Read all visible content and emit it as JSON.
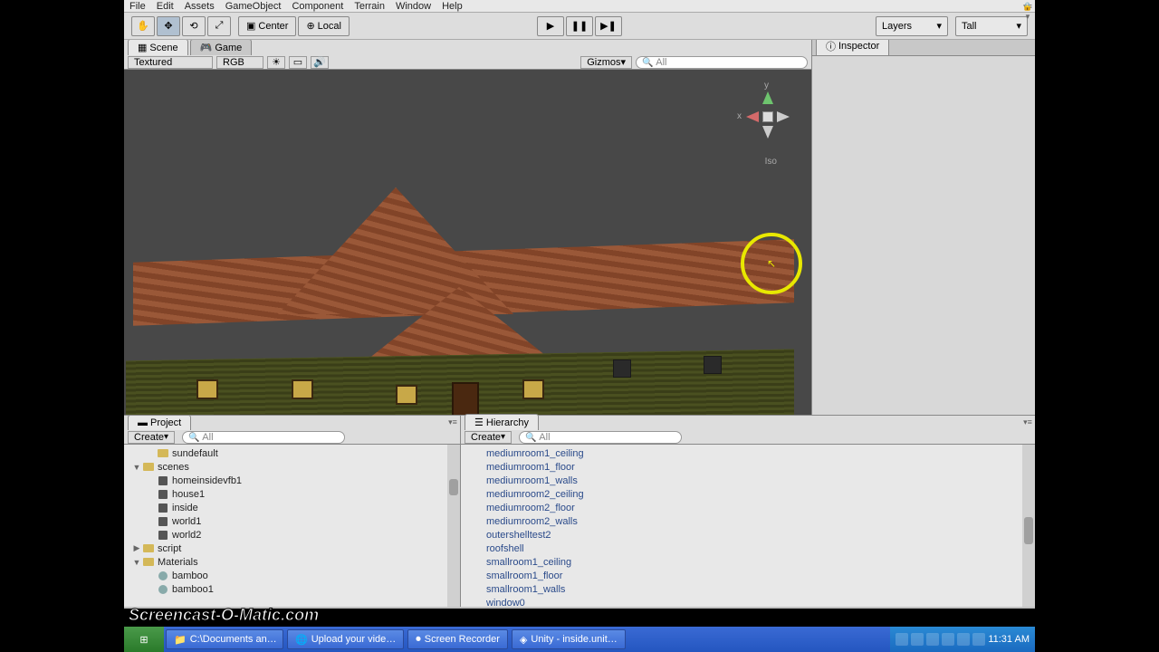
{
  "menu": [
    "File",
    "Edit",
    "Assets",
    "GameObject",
    "Component",
    "Terrain",
    "Window",
    "Help"
  ],
  "toolbar": {
    "pivot": "Center",
    "handle": "Local",
    "layers": "Layers",
    "layout": "Tall"
  },
  "scene": {
    "tabs": {
      "scene": "Scene",
      "game": "Game"
    },
    "render": "Textured",
    "color": "RGB",
    "gizmos": "Gizmos",
    "search": "All",
    "iso": "Iso",
    "axes": {
      "x": "x",
      "y": "y"
    }
  },
  "inspector": {
    "title": "Inspector"
  },
  "panels": {
    "project": "Project",
    "hierarchy": "Hierarchy",
    "create": "Create",
    "search": "All"
  },
  "project_tree": [
    {
      "indent": 1,
      "tw": "",
      "type": "folder",
      "name": "sundefault"
    },
    {
      "indent": 0,
      "tw": "▼",
      "type": "folder",
      "name": "scenes"
    },
    {
      "indent": 1,
      "tw": "",
      "type": "unity",
      "name": "homeinsidevfb1"
    },
    {
      "indent": 1,
      "tw": "",
      "type": "unity",
      "name": "house1"
    },
    {
      "indent": 1,
      "tw": "",
      "type": "unity",
      "name": "inside"
    },
    {
      "indent": 1,
      "tw": "",
      "type": "unity",
      "name": "world1"
    },
    {
      "indent": 1,
      "tw": "",
      "type": "unity",
      "name": "world2"
    },
    {
      "indent": 0,
      "tw": "▶",
      "type": "folder",
      "name": "script"
    },
    {
      "indent": 0,
      "tw": "▼",
      "type": "folder",
      "name": "Materials"
    },
    {
      "indent": 1,
      "tw": "",
      "type": "mat",
      "name": "bamboo"
    },
    {
      "indent": 1,
      "tw": "",
      "type": "mat",
      "name": "bamboo1"
    }
  ],
  "hierarchy_items": [
    "mediumroom1_ceiling",
    "mediumroom1_floor",
    "mediumroom1_walls",
    "mediumroom2_ceiling",
    "mediumroom2_floor",
    "mediumroom2_walls",
    "outershelltest2",
    "roofshell",
    "smallroom1_ceiling",
    "smallroom1_floor",
    "smallroom1_walls",
    "window0"
  ],
  "watermark": "Screencast-O-Matic.com",
  "taskbar": {
    "items": [
      "C:\\Documents an…",
      "Upload your vide…",
      "Screen Recorder",
      "Unity - inside.unit…"
    ],
    "time": "11:31 AM"
  }
}
